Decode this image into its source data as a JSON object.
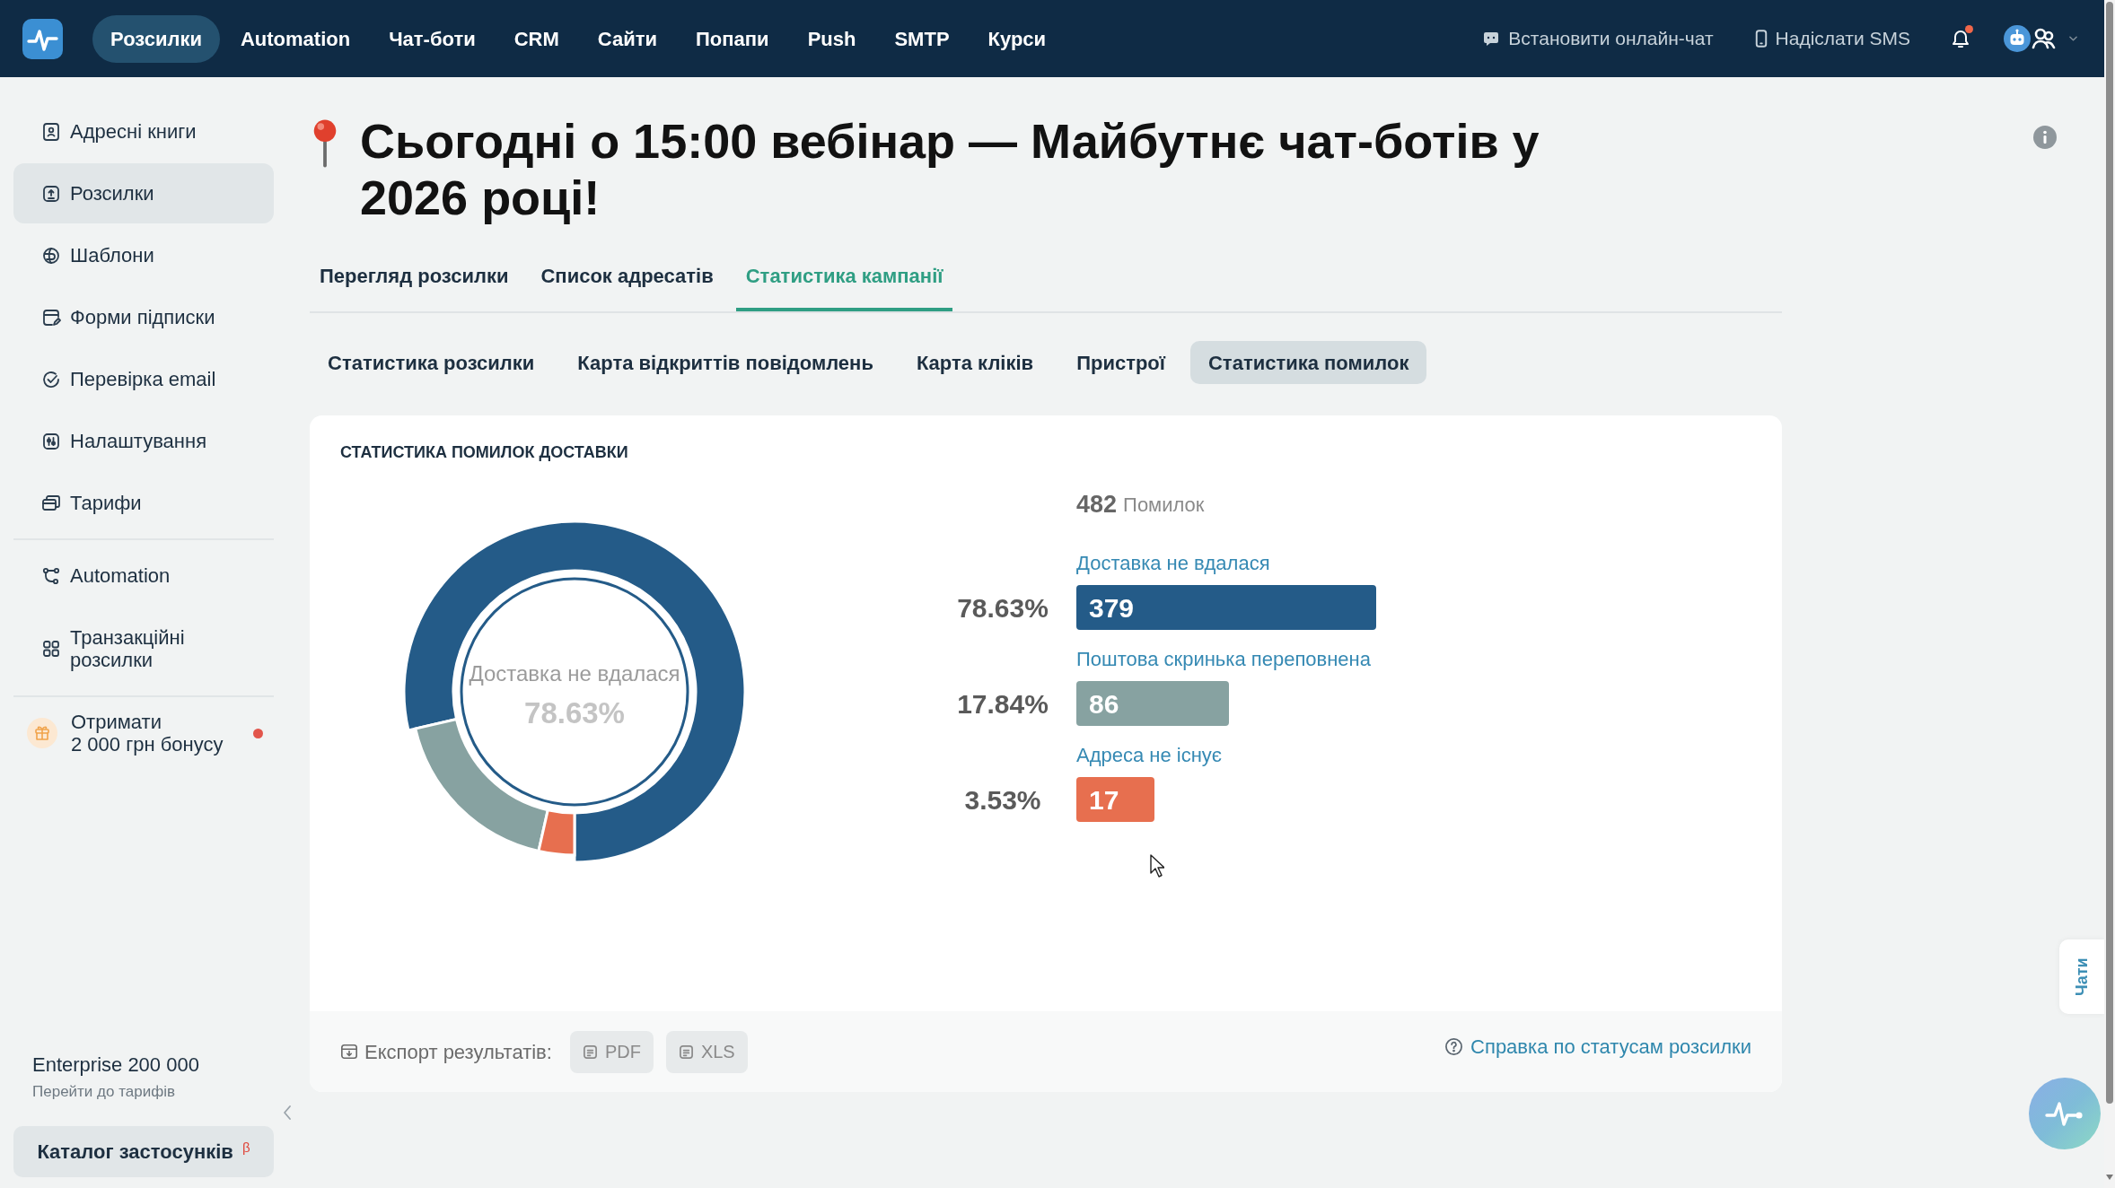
{
  "top_nav": {
    "items": [
      {
        "label": "Розсилки",
        "selected": true
      },
      {
        "label": "Automation",
        "selected": false
      },
      {
        "label": "Чат-боти",
        "selected": false
      },
      {
        "label": "CRM",
        "selected": false
      },
      {
        "label": "Сайти",
        "selected": false
      },
      {
        "label": "Попапи",
        "selected": false
      },
      {
        "label": "Push",
        "selected": false
      },
      {
        "label": "SMTP",
        "selected": false
      },
      {
        "label": "Курси",
        "selected": false
      }
    ],
    "actions": [
      {
        "kind": "chat",
        "label": "Встановити онлайн-чат"
      },
      {
        "kind": "sms",
        "label": "Надіслати SMS"
      }
    ],
    "notifications": {
      "unread": true
    }
  },
  "sidebar": {
    "groups": [
      {
        "items": [
          {
            "label": "Адресні книги",
            "selected": false
          },
          {
            "label": "Розсилки",
            "selected": true
          },
          {
            "label": "Шаблони",
            "selected": false
          },
          {
            "label": "Форми підписки",
            "selected": false
          },
          {
            "label": "Перевірка email",
            "selected": false
          },
          {
            "label": "Налаштування",
            "selected": false
          },
          {
            "label": "Тарифи",
            "selected": false
          }
        ]
      },
      {
        "items": [
          {
            "label": "Automation",
            "selected": false
          },
          {
            "label": "Транзакційні розсилки",
            "selected": false
          }
        ]
      }
    ],
    "promo": {
      "label": "Отримати\n2 000 грн бонусу",
      "new": true
    },
    "plan": {
      "name": "Enterprise 200 000",
      "link": "Перейти до тарифів"
    },
    "catalog_button": {
      "label": "Каталог застосунків $^{β}$"
    }
  },
  "page": {
    "title": "Сьогодні о 15:00 вебінар — Майбутнє чат-ботів у 2026 році!",
    "tabs": [
      {
        "label": "Перегляд розсилки",
        "selected": false
      },
      {
        "label": "Список адресатів",
        "selected": false
      },
      {
        "label": "Статистика кампанії",
        "selected": true
      }
    ],
    "subtabs": [
      {
        "label": "Статистика розсилки",
        "selected": false
      },
      {
        "label": "Карта відкриттів повідомлень",
        "selected": false
      },
      {
        "label": "Карта кліків",
        "selected": false
      },
      {
        "label": "Пристрої",
        "selected": false
      },
      {
        "label": "Статистика помилок",
        "selected": true
      }
    ],
    "card": {
      "title": "СТАТИСТИКА ПОМИЛОК ДОСТАВКИ",
      "chart_data": {
        "type": "donut",
        "categories": [
          "Доставка не вдалася",
          "Поштова скринька переповнена",
          "Адреса не існує"
        ],
        "values": [
          78.63,
          17.84,
          3.53
        ]
      },
      "donut_center": {
        "label": "Доставка не вдалася",
        "value": "78.63%"
      },
      "total": {
        "value": "482",
        "label": "Помилок"
      },
      "breakdown": [
        {
          "percent": "78.63%",
          "count": "379",
          "color": "#245b88"
        },
        {
          "percent": "17.84%",
          "count": "86",
          "color": "#87a2a1"
        },
        {
          "percent": "3.53%",
          "count": "17",
          "color": "#e76f4f"
        }
      ],
      "export": {
        "label": "Експорт результатів:",
        "buttons": [
          "PDF",
          "XLS"
        ]
      },
      "help_link": "Справка по статусам розсилки"
    }
  },
  "chat_tab": {
    "label": "Чати"
  }
}
